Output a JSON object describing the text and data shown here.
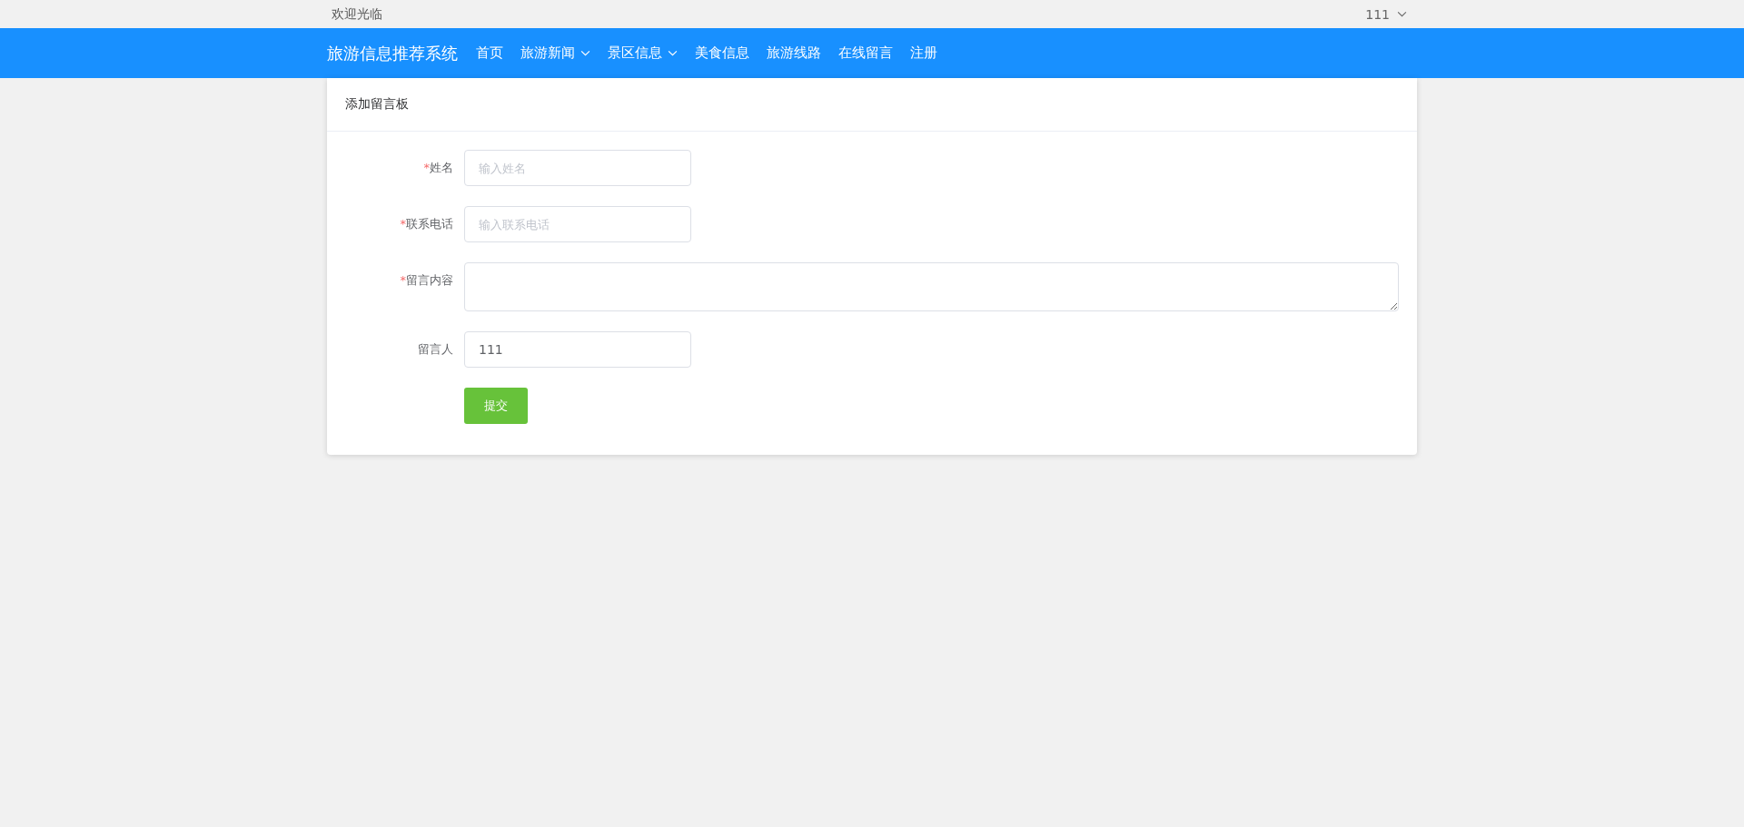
{
  "top_bar": {
    "greeting": "欢迎光临",
    "user": {
      "name": "111"
    }
  },
  "nav": {
    "brand": "旅游信息推荐系统",
    "items": [
      {
        "label": "首页",
        "has_dropdown": false
      },
      {
        "label": "旅游新闻",
        "has_dropdown": true
      },
      {
        "label": "景区信息",
        "has_dropdown": true
      },
      {
        "label": "美食信息",
        "has_dropdown": false
      },
      {
        "label": "旅游线路",
        "has_dropdown": false
      },
      {
        "label": "在线留言",
        "has_dropdown": false
      },
      {
        "label": "注册",
        "has_dropdown": false
      }
    ]
  },
  "form": {
    "title": "添加留言板",
    "required_mark": "*",
    "fields": [
      {
        "kind": "input",
        "label": "姓名",
        "required": true,
        "placeholder": "输入姓名"
      },
      {
        "kind": "input",
        "label": "联系电话",
        "required": true,
        "placeholder": "输入联系电话"
      },
      {
        "kind": "textarea",
        "label": "留言内容",
        "required": true
      },
      {
        "kind": "input",
        "label": "留言人",
        "required": false,
        "value": "111"
      }
    ],
    "submit": "提交"
  }
}
